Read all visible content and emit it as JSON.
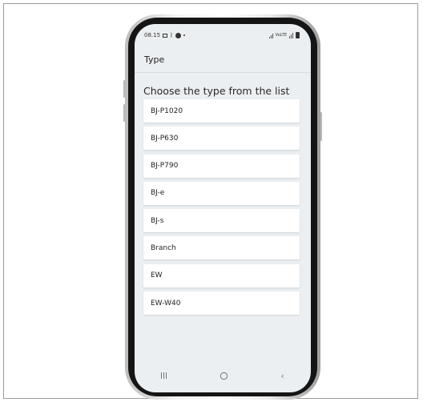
{
  "status_bar": {
    "time": "08.15",
    "network_label": "VoLTE"
  },
  "app_bar": {
    "title": "Type"
  },
  "main": {
    "heading": "Choose the type from the list",
    "items": [
      {
        "label": "BJ-P1020"
      },
      {
        "label": "BJ-P630"
      },
      {
        "label": "BJ-P790"
      },
      {
        "label": "BJ-e"
      },
      {
        "label": "BJ-s"
      },
      {
        "label": "Branch"
      },
      {
        "label": "EW"
      },
      {
        "label": "EW-W40"
      }
    ]
  },
  "nav_bar": {
    "icons": [
      "recents-icon",
      "home-icon",
      "back-icon"
    ]
  },
  "colors": {
    "screen_background": "#eceff1",
    "card_background": "#ffffff",
    "text": "#222222"
  }
}
